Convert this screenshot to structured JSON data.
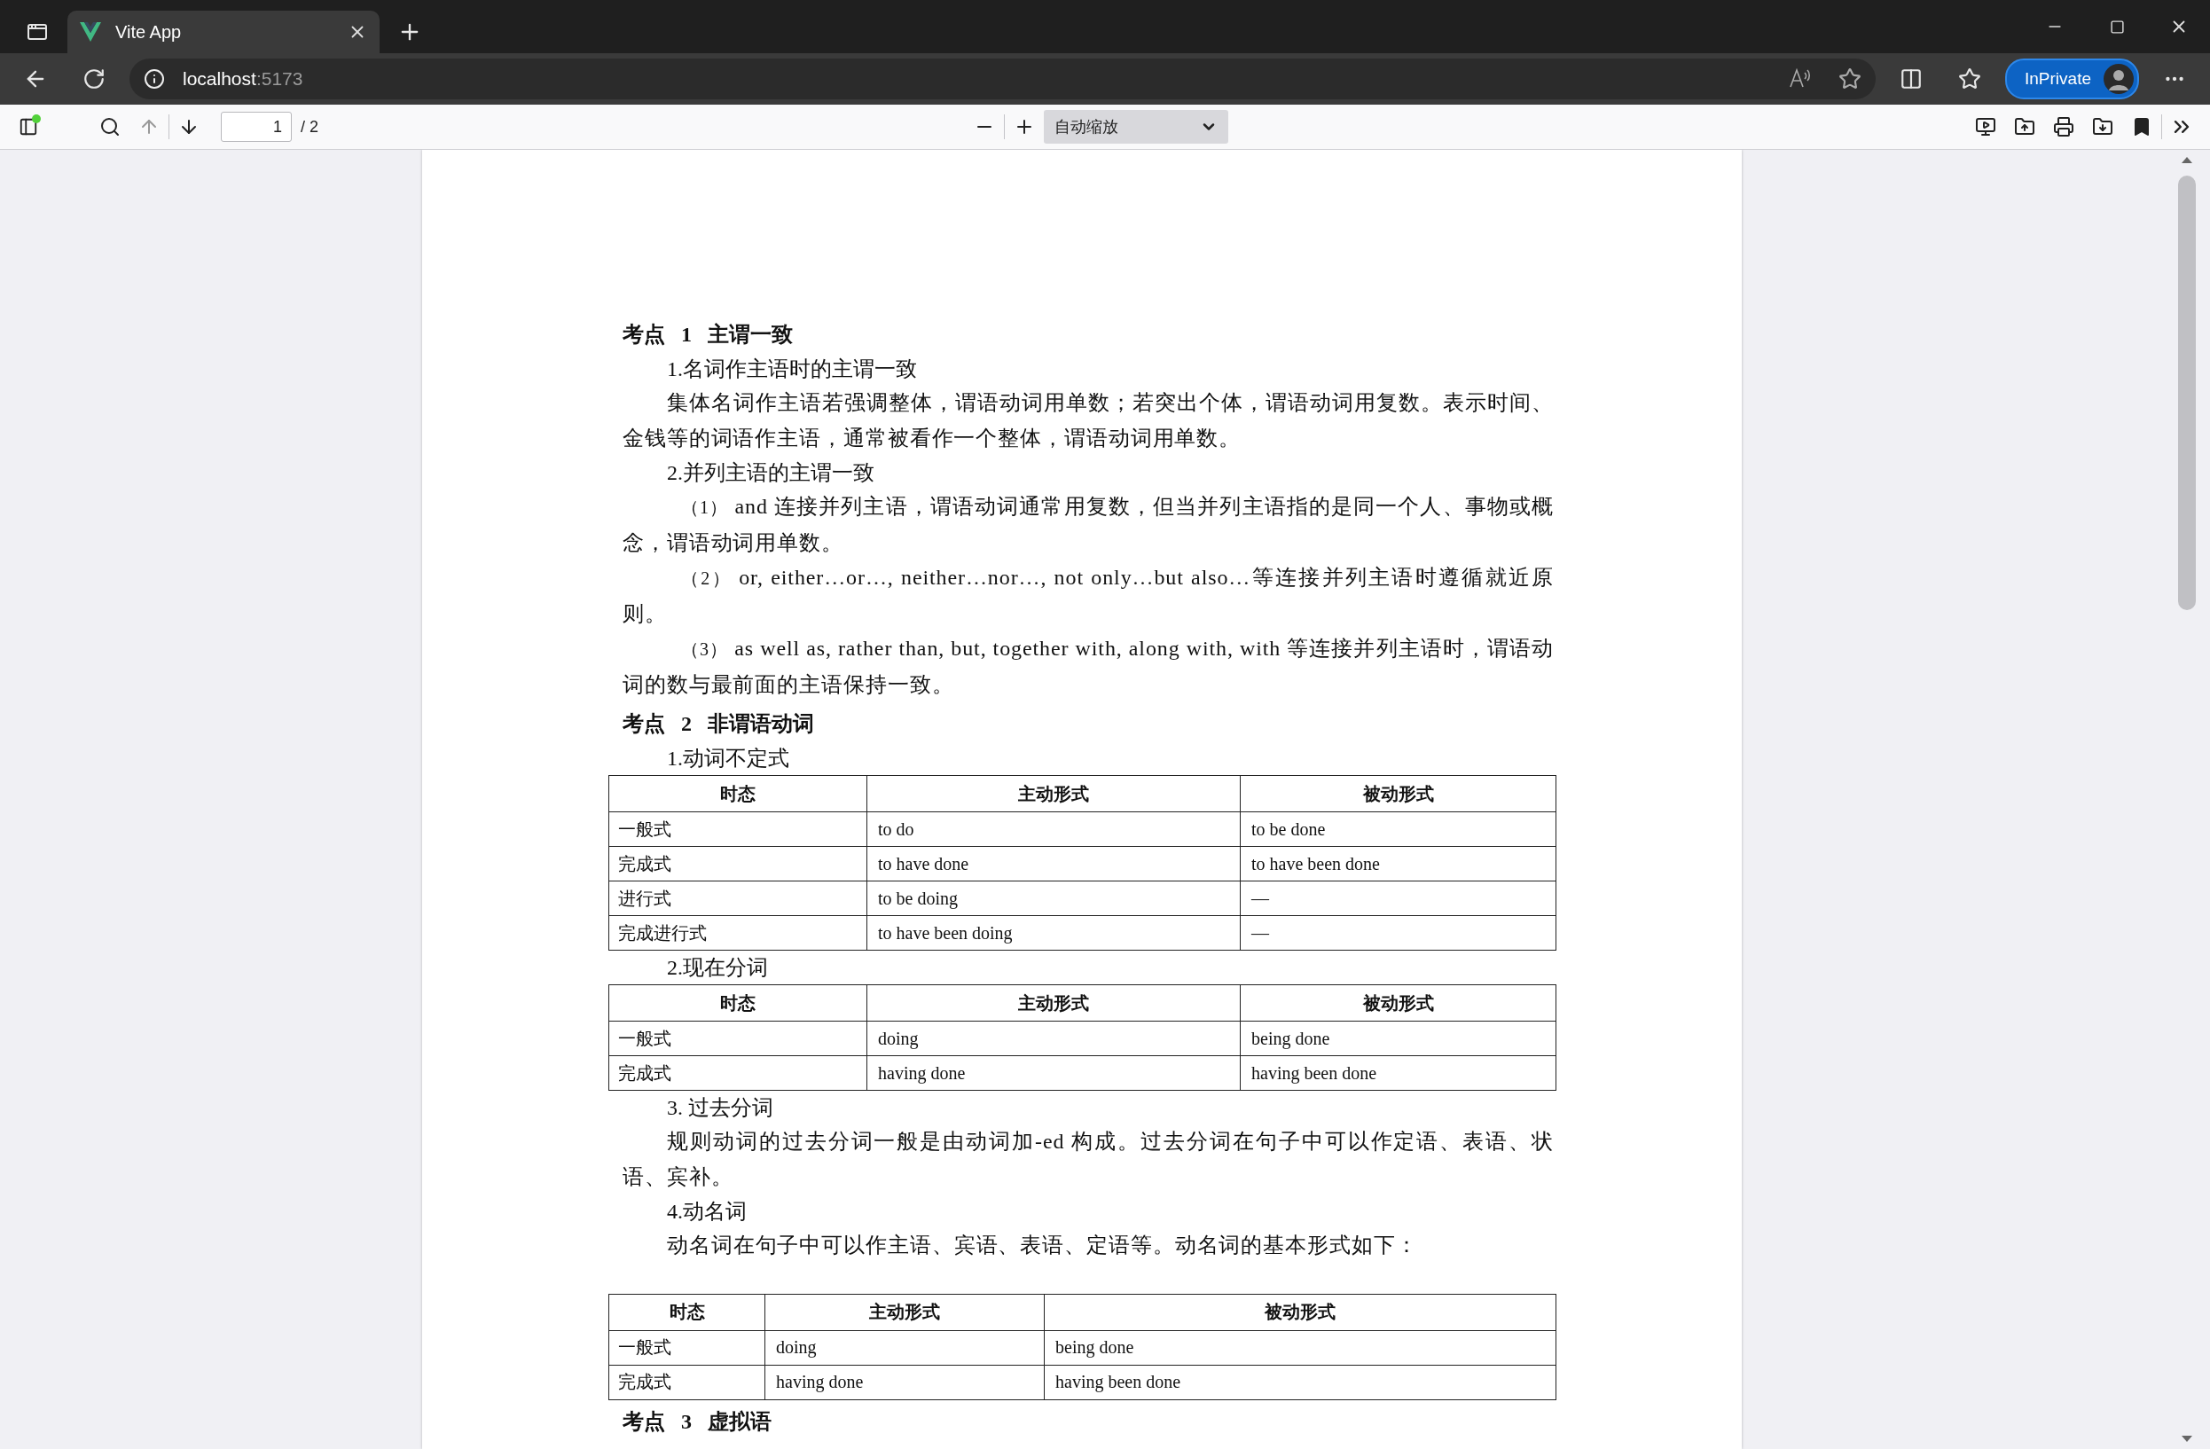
{
  "browser": {
    "tab": {
      "title": "Vite App",
      "selected": true
    },
    "address": {
      "host": "localhost",
      "port": ":5173"
    },
    "private_badge": "InPrivate"
  },
  "pdf_toolbar": {
    "page_number": "1",
    "page_count": "/ 2",
    "zoom": "自动缩放"
  },
  "document": {
    "blocks": [
      {
        "kind": "heading",
        "text": "考点 1 主谓一致"
      },
      {
        "kind": "subheading",
        "text": "1.名词作主语时的主谓一致"
      },
      {
        "kind": "paragraph",
        "text": "集体名词作主语若强调整体，谓语动词用单数；若突出个体，谓语动词用复数。表示时间、金钱等的词语作主语，通常被看作一个整体，谓语动词用单数。"
      },
      {
        "kind": "subheading",
        "text": "2.并列主语的主谓一致"
      },
      {
        "kind": "item",
        "marker": "（1）",
        "text": "and 连接并列主语，谓语动词通常用复数，但当并列主语指的是同一个人、事物或概念，谓语动词用单数。"
      },
      {
        "kind": "item",
        "marker": "（2）",
        "text": "or, either…or…, neither…nor…, not only…but also…等连接并列主语时遵循就近原则。"
      },
      {
        "kind": "item",
        "marker": "（3）",
        "text": "as well as, rather than, but, together with, along with, with 等连接并列主语时，谓语动词的数与最前面的主语保持一致。"
      },
      {
        "kind": "heading",
        "text": "考点 2 非谓语动词"
      },
      {
        "kind": "subheading",
        "text": "1.动词不定式"
      },
      {
        "kind": "table",
        "columns": [
          "时态",
          "主动形式",
          "被动形式"
        ],
        "rows": [
          [
            "一般式",
            "to do",
            "to be done"
          ],
          [
            "完成式",
            "to have done",
            "to have been done"
          ],
          [
            "进行式",
            "to be doing",
            "—"
          ],
          [
            "完成进行式",
            "to have been doing",
            "—"
          ]
        ]
      },
      {
        "kind": "subheading",
        "text": "2.现在分词"
      },
      {
        "kind": "table",
        "columns": [
          "时态",
          "主动形式",
          "被动形式"
        ],
        "rows": [
          [
            "一般式",
            "doing",
            "being done"
          ],
          [
            "完成式",
            "having done",
            "having been done"
          ]
        ]
      },
      {
        "kind": "subheading",
        "text": "3. 过去分词"
      },
      {
        "kind": "paragraph",
        "text": "规则动词的过去分词一般是由动词加-ed 构成。过去分词在句子中可以作定语、表语、状语、宾补。"
      },
      {
        "kind": "subheading",
        "text": "4.动名词"
      },
      {
        "kind": "paragraph",
        "text": "动名词在句子中可以作主语、宾语、表语、定语等。动名词的基本形式如下："
      },
      {
        "kind": "table",
        "columns": [
          "时态",
          "主动形式",
          "被动形式"
        ],
        "rows": [
          [
            "一般式",
            "doing",
            "being done"
          ],
          [
            "完成式",
            "having done",
            "having been done"
          ]
        ]
      },
      {
        "kind": "heading",
        "text": "考点 3 虚拟语"
      }
    ]
  }
}
